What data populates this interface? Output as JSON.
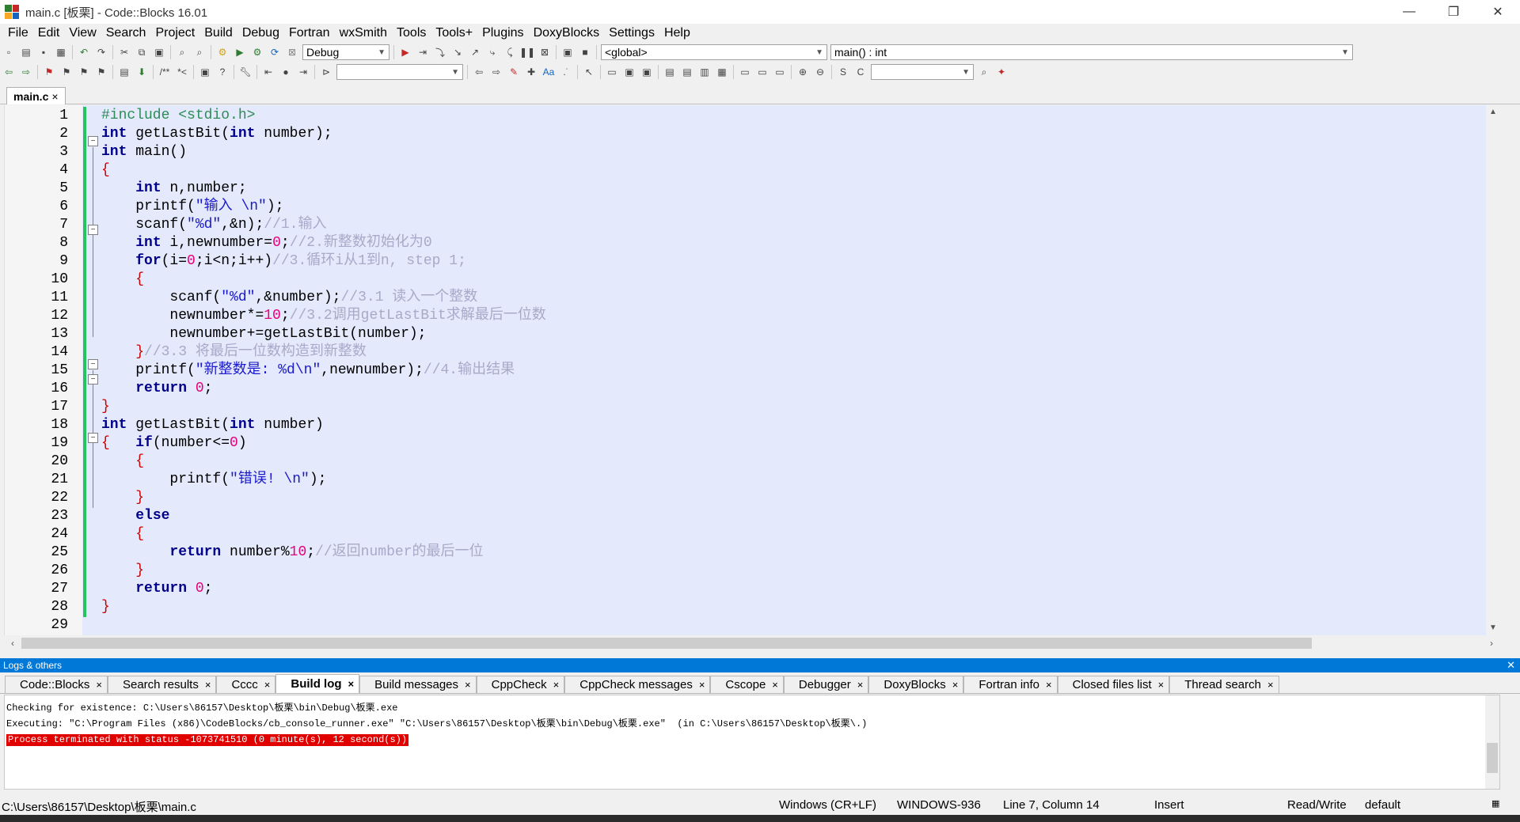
{
  "window": {
    "title": "main.c [板栗] - Code::Blocks 16.01",
    "controls": [
      "—",
      "❐",
      "✕"
    ]
  },
  "menu": [
    "File",
    "Edit",
    "View",
    "Search",
    "Project",
    "Build",
    "Debug",
    "Fortran",
    "wxSmith",
    "Tools",
    "Tools+",
    "Plugins",
    "DoxyBlocks",
    "Settings",
    "Help"
  ],
  "toolbar": {
    "build_target": "Debug",
    "scope": "<global>",
    "function": "main() : int",
    "search_combo": "",
    "search_combo2": ""
  },
  "editor": {
    "tab_label": "main.c",
    "tab_close": "×",
    "line_numbers": [
      "1",
      "2",
      "3",
      "4",
      "5",
      "6",
      "7",
      "8",
      "9",
      "10",
      "11",
      "12",
      "13",
      "14",
      "15",
      "16",
      "17",
      "18",
      "19",
      "20",
      "21",
      "22",
      "23",
      "24",
      "25",
      "26",
      "27",
      "28",
      "29"
    ]
  },
  "code": {
    "l1": "#include <stdio.h>",
    "kw_int": "int",
    "kw_for": "for",
    "kw_return": "return",
    "kw_if": "if",
    "kw_else": "else",
    "l2_rest": " getLastBit(",
    "l2_rest2": " number);",
    "l3_rest": " main()",
    "l5_rest": " n,number;",
    "l6_fn": "printf(",
    "l6_str": "\"输入 \\n\"",
    "l6_end": ");",
    "l7_fn": "scanf(",
    "l7_str": "\"%d\"",
    "l7_mid": ",&n);",
    "l7_cmt": "//1.输入",
    "l8_rest": " i,newnumber=",
    "l8_num": "0",
    "l8_end": ";",
    "l8_cmt": "//2.新整数初始化为0",
    "l9_a": "(i=",
    "l9_b": ";i<n;i++)",
    "l9_cmt": "//3.循环i从1到n, step 1;",
    "l11_fn": "scanf(",
    "l11_str": "\"%d\"",
    "l11_mid": ",&number);",
    "l11_cmt": "//3.1 读入一个整数",
    "l12_a": "newnumber*=",
    "l12_num": "10",
    "l12_end": ";",
    "l12_cmt": "//3.2调用getLastBit求解最后一位数",
    "l13": "newnumber+=getLastBit(number);",
    "l14_cmt": "//3.3 将最后一位数构造到新整数",
    "l15_fn": "printf(",
    "l15_str": "\"新整数是: %d\\n\"",
    "l15_mid": ",newnumber);",
    "l15_cmt": "//4.输出结果",
    "l16_num": "0",
    "l16_end": ";",
    "l18_rest": " getLastBit(",
    "l18_end": " number)",
    "l19_rest": "(number<=",
    "l19_num": "0",
    "l19_end": ")",
    "l21_fn": "printf(",
    "l21_str": "\"错误! \\n\"",
    "l21_end": ");",
    "l25_rest": " number%",
    "l25_num": "10",
    "l25_end": ";",
    "l25_cmt": "//返回number的最后一位",
    "l27_num": "0",
    "l27_end": ";",
    "brace_open": "{",
    "brace_close": "}"
  },
  "logs": {
    "header": "Logs & others",
    "tabs": [
      "Code::Blocks",
      "Search results",
      "Cccc",
      "Build log",
      "Build messages",
      "CppCheck",
      "CppCheck messages",
      "Cscope",
      "Debugger",
      "DoxyBlocks",
      "Fortran info",
      "Closed files list",
      "Thread search"
    ],
    "active_tab": "Build log",
    "lines": [
      "Checking for existence: C:\\Users\\86157\\Desktop\\板栗\\bin\\Debug\\板栗.exe",
      "Executing: \"C:\\Program Files (x86)\\CodeBlocks/cb_console_runner.exe\" \"C:\\Users\\86157\\Desktop\\板栗\\bin\\Debug\\板栗.exe\"  (in C:\\Users\\86157\\Desktop\\板栗\\.)"
    ],
    "error_line": "Process terminated with status -1073741510 (0 minute(s), 12 second(s))"
  },
  "status": {
    "path": "C:\\Users\\86157\\Desktop\\板栗\\main.c",
    "eol": "Windows (CR+LF)",
    "encoding": "WINDOWS-936",
    "position": "Line 7, Column 14",
    "mode": "Insert",
    "access": "Read/Write",
    "profile": "default"
  },
  "colors": {
    "editor_bg": "#e4e9fb",
    "keyword": "#00008b",
    "string": "#1a1acc",
    "number": "#e6007a",
    "comment": "#a9a9c9",
    "preprocessor": "#2e8b57",
    "change_bar": "#22c55e",
    "panel_header": "#0078d7",
    "error_bg": "#e00000"
  }
}
